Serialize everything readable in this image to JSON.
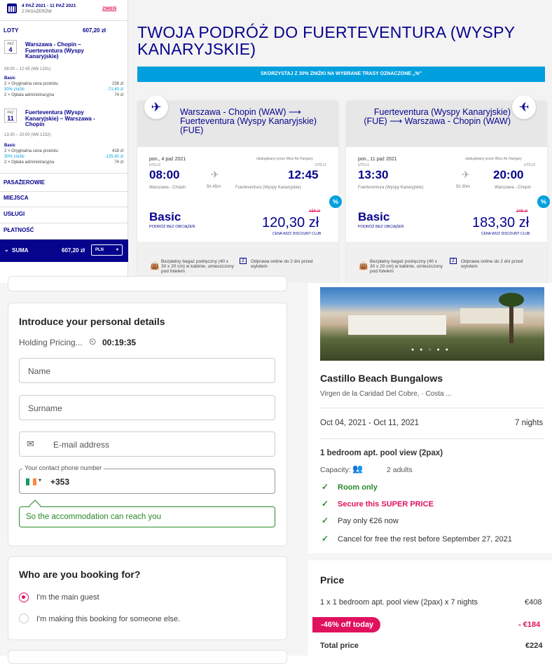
{
  "wizz": {
    "sidebar": {
      "dates": "4 PAŹ 2021 - 11 PAŹ 2021",
      "passengers": "2 PASAŻERÓW",
      "change": "ZMIEŃ",
      "flights_label": "LOTY",
      "flights_total": "607,20 zł",
      "out": {
        "month": "PAŹ",
        "day": "4",
        "route": "Warszawa - Chopin – Fuerteventura (Wyspy Kanaryjskie)",
        "time": "08:00 – 12:45 (W6 1331)",
        "fare": "Basic",
        "line1": "2 × Oryginalna cena przelotu",
        "val1": "238 zł",
        "line2": "30% zniżki",
        "val2": "-71,40 zł",
        "line3": "2 × Opłata administracyjna",
        "val3": "74 zł"
      },
      "ret": {
        "month": "PAŹ",
        "day": "11",
        "route": "Fuerteventura (Wyspy Kanaryjskie) – Warszawa - Chopin",
        "time": "13:30 – 20:00 (W6 1332)",
        "fare": "Basic",
        "line1": "2 × Oryginalna cena przelotu",
        "val1": "418 zł",
        "line2": "30% zniżki",
        "val2": "-125,40 zł",
        "line3": "2 × Opłata administracyjna",
        "val3": "74 zł"
      },
      "sections": [
        "PASAŻEROWIE",
        "MIEJSCA",
        "USŁUGI",
        "PŁATNOŚĆ"
      ],
      "sum_label": "SUMA",
      "sum_value": "607,20 zł",
      "currency": "PLN"
    },
    "title": "TWOJA PODRÓŻ DO FUERTEVENTURA (WYSPY KANARYJSKIE)",
    "banner": "SKORZYSTAJ Z 30% ZNIŻKI NA WYBRANE TRASY OZNACZONE „%\"",
    "cards": [
      {
        "route": "Warszawa - Chopin (WAW) ⟶ Fuerteventura (Wyspy Kanaryjskie) (FUE)",
        "date": "pon., 4 paź 2021",
        "operator": "obsługiwany przez Wizz Air Hungary",
        "utc_dep": "UTC+2",
        "utc_arr": "UTC+1",
        "dep": "08:00",
        "arr": "12:45",
        "from": "Warszawa - Chopin",
        "to": "Fuerteventura (Wyspy Kanaryjskie)",
        "duration": "5h 45m",
        "fare": "Basic",
        "fare_sub": "PODRÓŻ BEZ OBCIĄŻEŃ",
        "old_price": "156 zł",
        "price": "120,30 zł",
        "club": "CENA WIZZ DISCOUNT CLUB",
        "feat1": "Bezpłatny bagaż podręczny (40 x 30 x 20 cm) w kabinie, umieszczony pod fotelem",
        "feat2": "Odprawa online do 2 dni przed wylotem"
      },
      {
        "route": "Fuerteventura (Wyspy Kanaryjskie) (FUE) ⟶ Warszawa - Chopin (WAW)",
        "date": "pon., 11 paź 2021",
        "operator": "obsługiwany przez Wizz Air Hungary",
        "utc_dep": "UTC+1",
        "utc_arr": "UTC+2",
        "dep": "13:30",
        "arr": "20:00",
        "from": "Fuerteventura (Wyspy Kanaryjskie)",
        "to": "Warszawa - Chopin",
        "duration": "5h 30m",
        "fare": "Basic",
        "fare_sub": "PODRÓŻ BEZ OBCIĄŻEŃ",
        "old_price": "246 zł",
        "price": "183,30 zł",
        "club": "CENA WIZZ DISCOUNT CLUB",
        "feat1": "Bezpłatny bagaż podręczny (40 x 30 x 20 cm) w kabinie, umieszczony pod fotelem",
        "feat2": "Odprawa online do 2 dni przed wylotem"
      }
    ],
    "pct": "%"
  },
  "booking": {
    "form_title": "Introduce your personal details",
    "holding": "Holding Pricing...",
    "timer": "00:19:35",
    "name_ph": "Name",
    "surname_ph": "Surname",
    "email_ph": "E-mail address",
    "phone_label": "Your contact phone number",
    "phone_prefix": "+353",
    "phone_hint": "So the accommodation can reach you",
    "who_title": "Who are you booking for?",
    "opt_main": "I'm the main guest",
    "opt_other": "I'm making this booking for someone else.",
    "hotel_name": "Castillo Beach Bungalows",
    "hotel_loc": "Virgen de la Caridad Del Cobre, · Costa ...",
    "stay_dates": "Oct 04, 2021 - Oct 11, 2021",
    "nights": "7 nights",
    "room": "1 bedroom apt. pool view (2pax)",
    "capacity_label": "Capacity:",
    "capacity": "2 adults",
    "perks": [
      "Room only",
      "Secure this SUPER PRICE",
      "Pay only €26 now",
      "Cancel for free the rest before September 27, 2021"
    ],
    "price_title": "Price",
    "price_line": "1 x 1 bedroom apt. pool view (2pax) x 7 nights",
    "price_line_val": "€408",
    "discount_badge": "-46% off today",
    "discount_val": "- €184",
    "total_label": "Total price",
    "total_val": "€224",
    "colors": {
      "accent": "#e0115f",
      "green": "#2a8a2a",
      "wizz_blue": "#06038d",
      "teal": "#00a0df"
    }
  }
}
